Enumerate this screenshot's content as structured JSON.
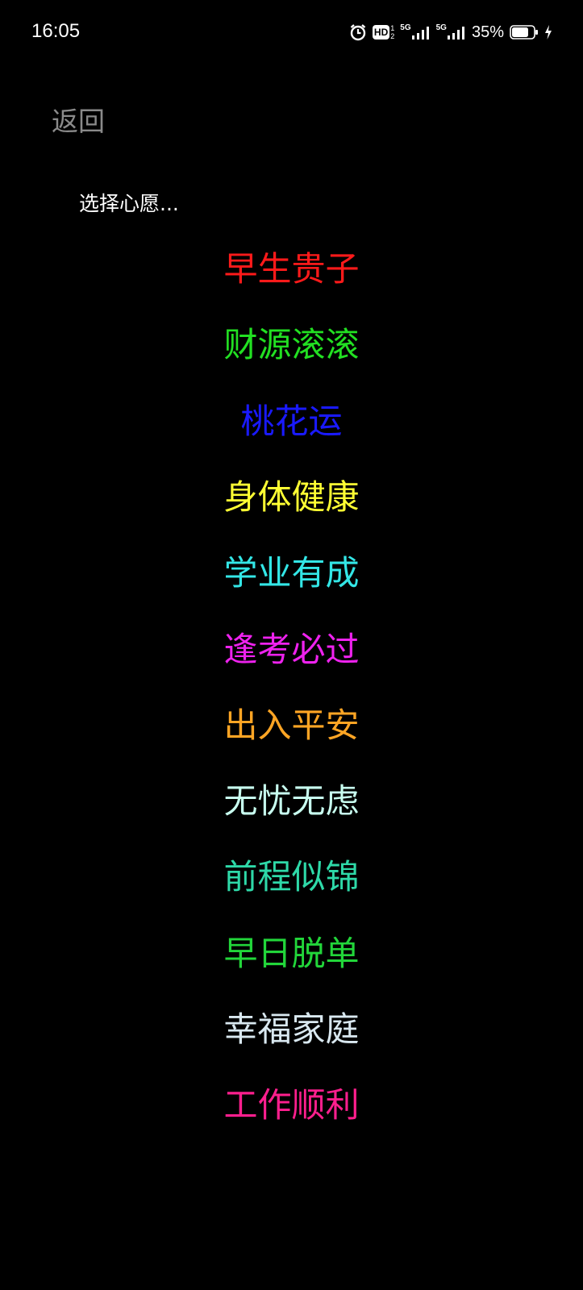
{
  "status_bar": {
    "time": "16:05",
    "icons": [
      "alarm-icon",
      "hd-voice-icon",
      "signal-5g-icon",
      "signal-5g-icon",
      "battery-icon",
      "charging-icon"
    ],
    "hd_badge": "HD",
    "sim_labels": [
      "1",
      "2"
    ],
    "network_labels": [
      "5G",
      "5G"
    ],
    "battery_percent": "35%",
    "battery_level": 0.35
  },
  "header": {
    "back_label": "返回"
  },
  "prompt": "选择心愿...",
  "wishes": [
    {
      "label": "早生贵子",
      "color": "#ff1a1a"
    },
    {
      "label": "财源滚滚",
      "color": "#22e022"
    },
    {
      "label": "桃花运",
      "color": "#1a1aff"
    },
    {
      "label": "身体健康",
      "color": "#ffff33"
    },
    {
      "label": "学业有成",
      "color": "#33e6e6"
    },
    {
      "label": "逢考必过",
      "color": "#ee22ee"
    },
    {
      "label": "出入平安",
      "color": "#ffa524"
    },
    {
      "label": "无忧无虑",
      "color": "#c8fff0"
    },
    {
      "label": "前程似锦",
      "color": "#2ed9a8"
    },
    {
      "label": "早日脱单",
      "color": "#22d63a"
    },
    {
      "label": "幸福家庭",
      "color": "#d9e8f0"
    },
    {
      "label": "工作顺利",
      "color": "#ff1f8e"
    }
  ]
}
